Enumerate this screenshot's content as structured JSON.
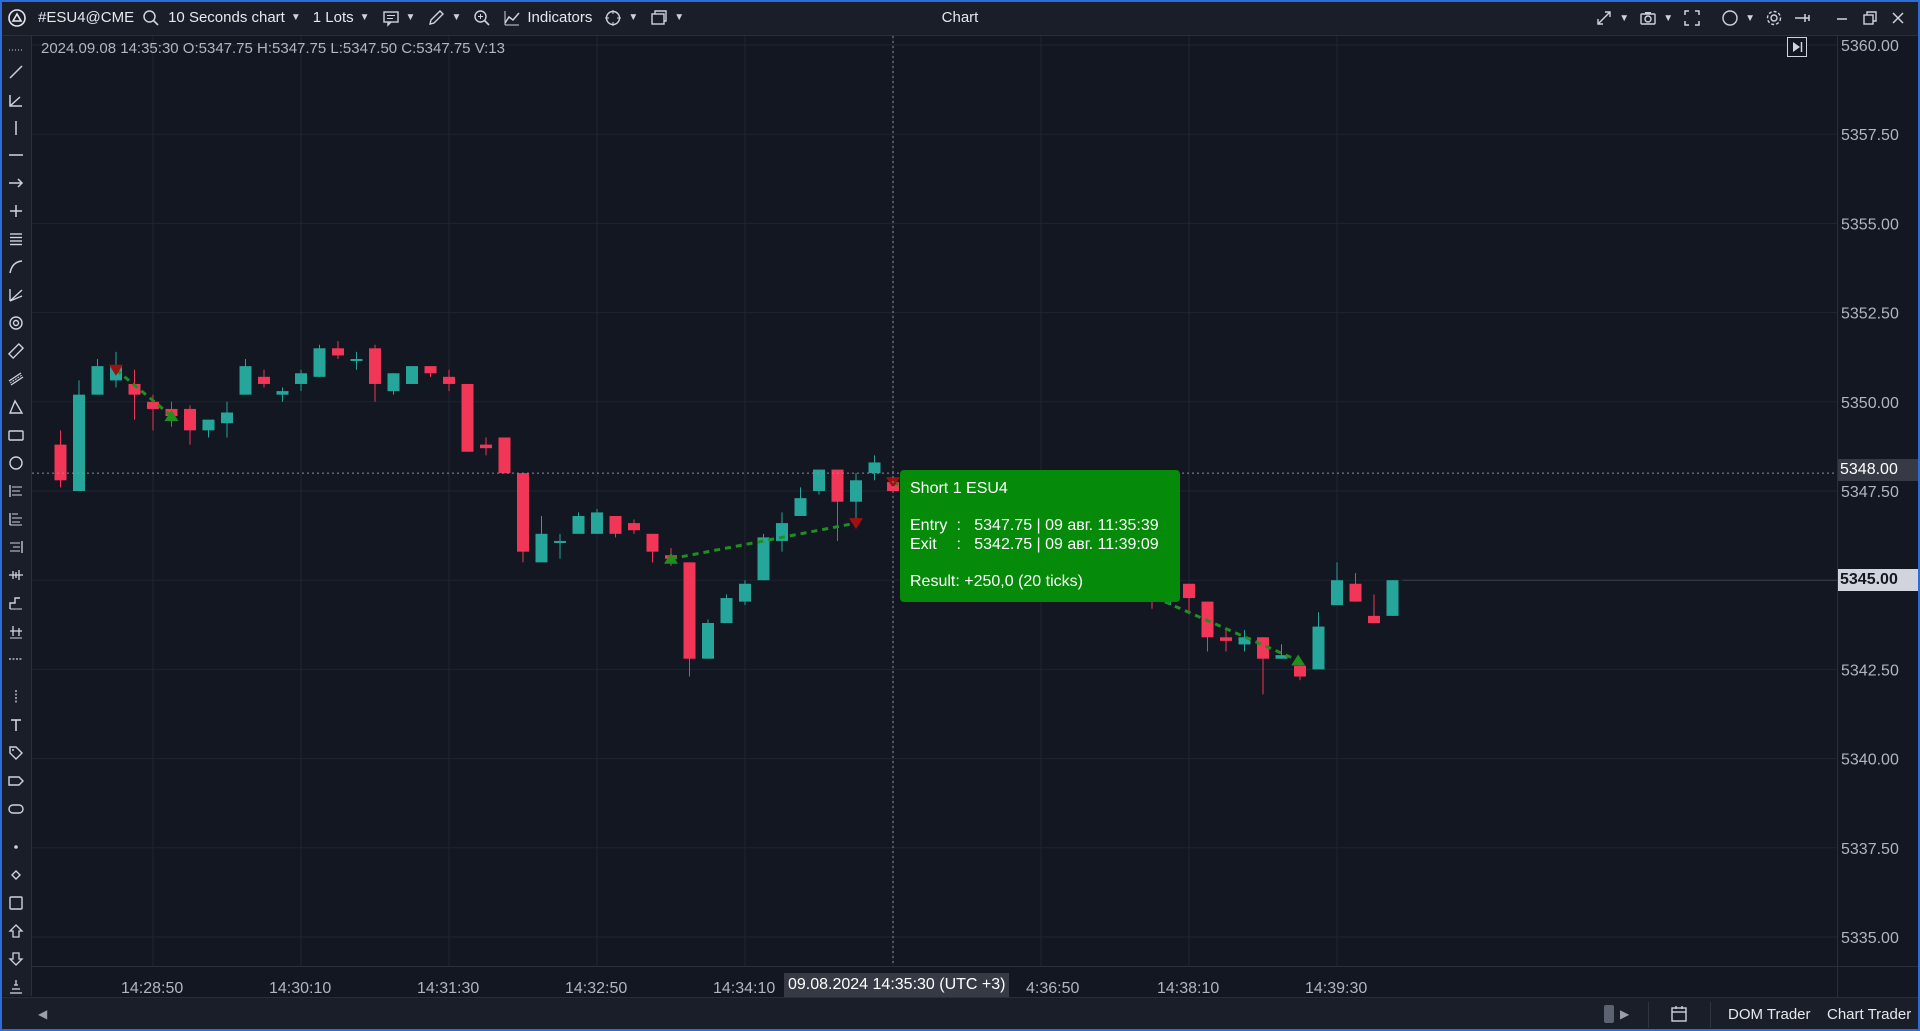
{
  "topbar": {
    "symbol": "#ESU4@CME",
    "timeframe": "10 Seconds chart",
    "lots": "1 Lots",
    "indicators_label": "Indicators",
    "window_title": "Chart"
  },
  "ohlc_line": "2024.09.08 14:35:30 O:5347.75 H:5347.75 L:5347.50 C:5347.75 V:13",
  "trade_tooltip": {
    "title": "Short 1 ESU4",
    "entry_label": "Entry",
    "entry_value": "5347.75 | 09 авг. 11:35:39",
    "exit_label": "Exit",
    "exit_value": "5342.75 | 09 авг. 11:39:09",
    "result_label": "Result",
    "result_value": "+250,0 (20 ticks)"
  },
  "crosshair": {
    "time_label": "09.08.2024 14:35:30 (UTC +3)",
    "price_label": "5348.00"
  },
  "last_price_label": "5345.00",
  "bottombar": {
    "dom_trader": "DOM Trader",
    "chart_trader": "Chart Trader"
  },
  "colors": {
    "background": "#131722",
    "up": "#26a69a",
    "down": "#f23658",
    "tooltip": "#068a0a",
    "trade_line": "#1f8f1f"
  },
  "icons": {
    "left_toolbar": [
      "cursor-dots-icon",
      "trend-line-icon",
      "angle-icon",
      "vertical-line-icon",
      "horizontal-line-icon",
      "arrow-icon",
      "crosshair-icon",
      "parallel-lines-icon",
      "curve-icon",
      "fan-icon",
      "spiral-icon",
      "ruler-icon",
      "channel-icon",
      "triangle-icon",
      "rectangle-icon",
      "circle-icon",
      "fib-retracement-icon",
      "fib-extension-icon",
      "fib-time-icon",
      "pitchfork-icon",
      "gann-icon",
      "price-range-icon",
      "date-range-icon",
      "date-price-range-icon",
      "text-icon",
      "tag-icon",
      "label-icon",
      "callout-icon",
      "dot-icon",
      "diamond-icon",
      "square-icon",
      "arrow-up-icon",
      "arrow-down-icon",
      "order-icon"
    ]
  },
  "chart_data": {
    "type": "candlestick",
    "ylim": [
      5333.75,
      5360.0
    ],
    "y_ticks": [
      5335.0,
      5337.5,
      5340.0,
      5342.5,
      5345.0,
      5347.5,
      5350.0,
      5352.5,
      5355.0,
      5357.5,
      5360.0
    ],
    "y_tick_labels": [
      "5335.00",
      "5337.50",
      "5340.00",
      "5342.50",
      "5345.00",
      "5347.50",
      "5350.00",
      "5352.50",
      "5355.00",
      "5357.50",
      "5360.00"
    ],
    "x_ticks": [
      "14:28:50",
      "14:30:10",
      "14:31:30",
      "14:32:50",
      "14:34:10",
      "14:35:30",
      "14:36:50",
      "14:38:10",
      "14:39:30"
    ],
    "x_tick_labels_visible": [
      "14:28:50",
      "14:30:10",
      "14:31:30",
      "14:32:50",
      "14:34:10",
      "4:36:50",
      "14:38:10",
      "14:39:30"
    ],
    "bar_interval": "10s",
    "candles": [
      {
        "t": "14:28:00",
        "o": 5348.8,
        "h": 5349.2,
        "l": 5347.6,
        "c": 5347.8
      },
      {
        "t": "14:28:10",
        "o": 5347.5,
        "h": 5350.6,
        "l": 5347.5,
        "c": 5350.2
      },
      {
        "t": "14:28:20",
        "o": 5350.2,
        "h": 5351.2,
        "l": 5350.2,
        "c": 5351.0
      },
      {
        "t": "14:28:30",
        "o": 5350.6,
        "h": 5351.4,
        "l": 5350.4,
        "c": 5351.0
      },
      {
        "t": "14:28:40",
        "o": 5350.5,
        "h": 5350.9,
        "l": 5349.5,
        "c": 5350.2
      },
      {
        "t": "14:28:50",
        "o": 5350.0,
        "h": 5350.2,
        "l": 5349.2,
        "c": 5349.8
      },
      {
        "t": "14:29:00",
        "o": 5349.8,
        "h": 5350.0,
        "l": 5349.3,
        "c": 5349.6
      },
      {
        "t": "14:29:10",
        "o": 5349.8,
        "h": 5349.9,
        "l": 5348.8,
        "c": 5349.2
      },
      {
        "t": "14:29:20",
        "o": 5349.2,
        "h": 5349.4,
        "l": 5349.0,
        "c": 5349.5
      },
      {
        "t": "14:29:30",
        "o": 5349.4,
        "h": 5350.0,
        "l": 5349.0,
        "c": 5349.7
      },
      {
        "t": "14:29:40",
        "o": 5350.2,
        "h": 5351.2,
        "l": 5350.2,
        "c": 5351.0
      },
      {
        "t": "14:29:50",
        "o": 5350.7,
        "h": 5350.9,
        "l": 5350.4,
        "c": 5350.5
      },
      {
        "t": "14:30:00",
        "o": 5350.2,
        "h": 5350.4,
        "l": 5350.0,
        "c": 5350.3
      },
      {
        "t": "14:30:10",
        "o": 5350.5,
        "h": 5350.9,
        "l": 5350.3,
        "c": 5350.8
      },
      {
        "t": "14:30:20",
        "o": 5350.7,
        "h": 5351.6,
        "l": 5350.7,
        "c": 5351.5
      },
      {
        "t": "14:30:30",
        "o": 5351.5,
        "h": 5351.7,
        "l": 5351.2,
        "c": 5351.3
      },
      {
        "t": "14:30:40",
        "o": 5351.2,
        "h": 5351.4,
        "l": 5350.9,
        "c": 5351.2
      },
      {
        "t": "14:30:50",
        "o": 5351.5,
        "h": 5351.6,
        "l": 5350.0,
        "c": 5350.5
      },
      {
        "t": "14:31:00",
        "o": 5350.3,
        "h": 5350.8,
        "l": 5350.2,
        "c": 5350.8
      },
      {
        "t": "14:31:10",
        "o": 5350.5,
        "h": 5351.0,
        "l": 5350.5,
        "c": 5351.0
      },
      {
        "t": "14:31:20",
        "o": 5351.0,
        "h": 5351.0,
        "l": 5350.7,
        "c": 5350.8
      },
      {
        "t": "14:31:30",
        "o": 5350.7,
        "h": 5350.9,
        "l": 5350.3,
        "c": 5350.5
      },
      {
        "t": "14:31:40",
        "o": 5350.5,
        "h": 5350.5,
        "l": 5348.6,
        "c": 5348.6
      },
      {
        "t": "14:31:50",
        "o": 5348.8,
        "h": 5349.0,
        "l": 5348.5,
        "c": 5348.7
      },
      {
        "t": "14:32:00",
        "o": 5349.0,
        "h": 5349.0,
        "l": 5348.0,
        "c": 5348.0
      },
      {
        "t": "14:32:10",
        "o": 5348.0,
        "h": 5348.0,
        "l": 5345.5,
        "c": 5345.8
      },
      {
        "t": "14:32:20",
        "o": 5345.5,
        "h": 5346.8,
        "l": 5345.5,
        "c": 5346.3
      },
      {
        "t": "14:32:30",
        "o": 5346.1,
        "h": 5346.3,
        "l": 5345.6,
        "c": 5346.1
      },
      {
        "t": "14:32:40",
        "o": 5346.3,
        "h": 5346.9,
        "l": 5346.3,
        "c": 5346.8
      },
      {
        "t": "14:32:50",
        "o": 5346.3,
        "h": 5347.0,
        "l": 5346.3,
        "c": 5346.9
      },
      {
        "t": "14:33:00",
        "o": 5346.8,
        "h": 5346.8,
        "l": 5346.2,
        "c": 5346.3
      },
      {
        "t": "14:33:10",
        "o": 5346.6,
        "h": 5346.7,
        "l": 5346.3,
        "c": 5346.4
      },
      {
        "t": "14:33:20",
        "o": 5346.3,
        "h": 5346.3,
        "l": 5345.5,
        "c": 5345.8
      },
      {
        "t": "14:33:30",
        "o": 5345.7,
        "h": 5345.9,
        "l": 5345.4,
        "c": 5345.6
      },
      {
        "t": "14:33:40",
        "o": 5345.5,
        "h": 5345.5,
        "l": 5342.3,
        "c": 5342.8
      },
      {
        "t": "14:33:50",
        "o": 5342.8,
        "h": 5343.9,
        "l": 5342.8,
        "c": 5343.8
      },
      {
        "t": "14:34:00",
        "o": 5343.8,
        "h": 5344.6,
        "l": 5343.8,
        "c": 5344.5
      },
      {
        "t": "14:34:10",
        "o": 5344.4,
        "h": 5345.0,
        "l": 5344.3,
        "c": 5344.9
      },
      {
        "t": "14:34:20",
        "o": 5345.0,
        "h": 5346.3,
        "l": 5345.0,
        "c": 5346.2
      },
      {
        "t": "14:34:30",
        "o": 5346.1,
        "h": 5346.9,
        "l": 5345.8,
        "c": 5346.6
      },
      {
        "t": "14:34:40",
        "o": 5346.8,
        "h": 5347.6,
        "l": 5346.8,
        "c": 5347.3
      },
      {
        "t": "14:34:50",
        "o": 5347.5,
        "h": 5348.0,
        "l": 5347.4,
        "c": 5348.1
      },
      {
        "t": "14:35:00",
        "o": 5348.1,
        "h": 5348.1,
        "l": 5346.1,
        "c": 5347.2
      },
      {
        "t": "14:35:10",
        "o": 5347.2,
        "h": 5348.0,
        "l": 5346.6,
        "c": 5347.8
      },
      {
        "t": "14:35:20",
        "o": 5348.0,
        "h": 5348.5,
        "l": 5347.8,
        "c": 5348.3
      },
      {
        "t": "14:35:30",
        "o": 5347.75,
        "h": 5347.75,
        "l": 5347.5,
        "c": 5347.5
      },
      {
        "t": "14:37:50",
        "o": 5344.7,
        "h": 5344.9,
        "l": 5344.2,
        "c": 5344.5
      },
      {
        "t": "14:38:00",
        "o": 5344.6,
        "h": 5345.0,
        "l": 5344.3,
        "c": 5344.9
      },
      {
        "t": "14:38:10",
        "o": 5344.9,
        "h": 5344.9,
        "l": 5344.1,
        "c": 5344.5
      },
      {
        "t": "14:38:20",
        "o": 5344.4,
        "h": 5344.4,
        "l": 5343.0,
        "c": 5343.4
      },
      {
        "t": "14:38:30",
        "o": 5343.4,
        "h": 5343.6,
        "l": 5343.0,
        "c": 5343.3
      },
      {
        "t": "14:38:40",
        "o": 5343.2,
        "h": 5343.6,
        "l": 5343.0,
        "c": 5343.4
      },
      {
        "t": "14:38:50",
        "o": 5343.4,
        "h": 5343.4,
        "l": 5341.8,
        "c": 5342.8
      },
      {
        "t": "14:39:00",
        "o": 5342.8,
        "h": 5343.2,
        "l": 5342.8,
        "c": 5342.9
      },
      {
        "t": "14:39:10",
        "o": 5342.6,
        "h": 5342.8,
        "l": 5342.2,
        "c": 5342.3
      },
      {
        "t": "14:39:20",
        "o": 5342.5,
        "h": 5344.1,
        "l": 5342.5,
        "c": 5343.7
      },
      {
        "t": "14:39:30",
        "o": 5344.3,
        "h": 5345.5,
        "l": 5344.3,
        "c": 5345.0
      },
      {
        "t": "14:39:40",
        "o": 5344.9,
        "h": 5345.2,
        "l": 5344.4,
        "c": 5344.4
      },
      {
        "t": "14:39:50",
        "o": 5344.0,
        "h": 5344.6,
        "l": 5343.8,
        "c": 5343.8
      },
      {
        "t": "14:40:00",
        "o": 5344.0,
        "h": 5345.0,
        "l": 5344.0,
        "c": 5345.0
      }
    ],
    "trades": [
      {
        "entry_t": "14:28:30",
        "entry_price": 5350.9,
        "exit_t": "14:29:00",
        "exit_price": 5349.6,
        "side": "short"
      },
      {
        "entry_t": "14:33:30",
        "entry_price": 5345.6,
        "exit_t": "14:35:10",
        "exit_price": 5346.6,
        "side": "long"
      },
      {
        "entry_t": "14:35:30",
        "entry_price": 5347.75,
        "exit_t": "14:39:09",
        "exit_price": 5342.75,
        "side": "short"
      }
    ],
    "crosshair_t": "14:35:30",
    "crosshair_price": 5348.0,
    "last_price": 5345.0
  }
}
